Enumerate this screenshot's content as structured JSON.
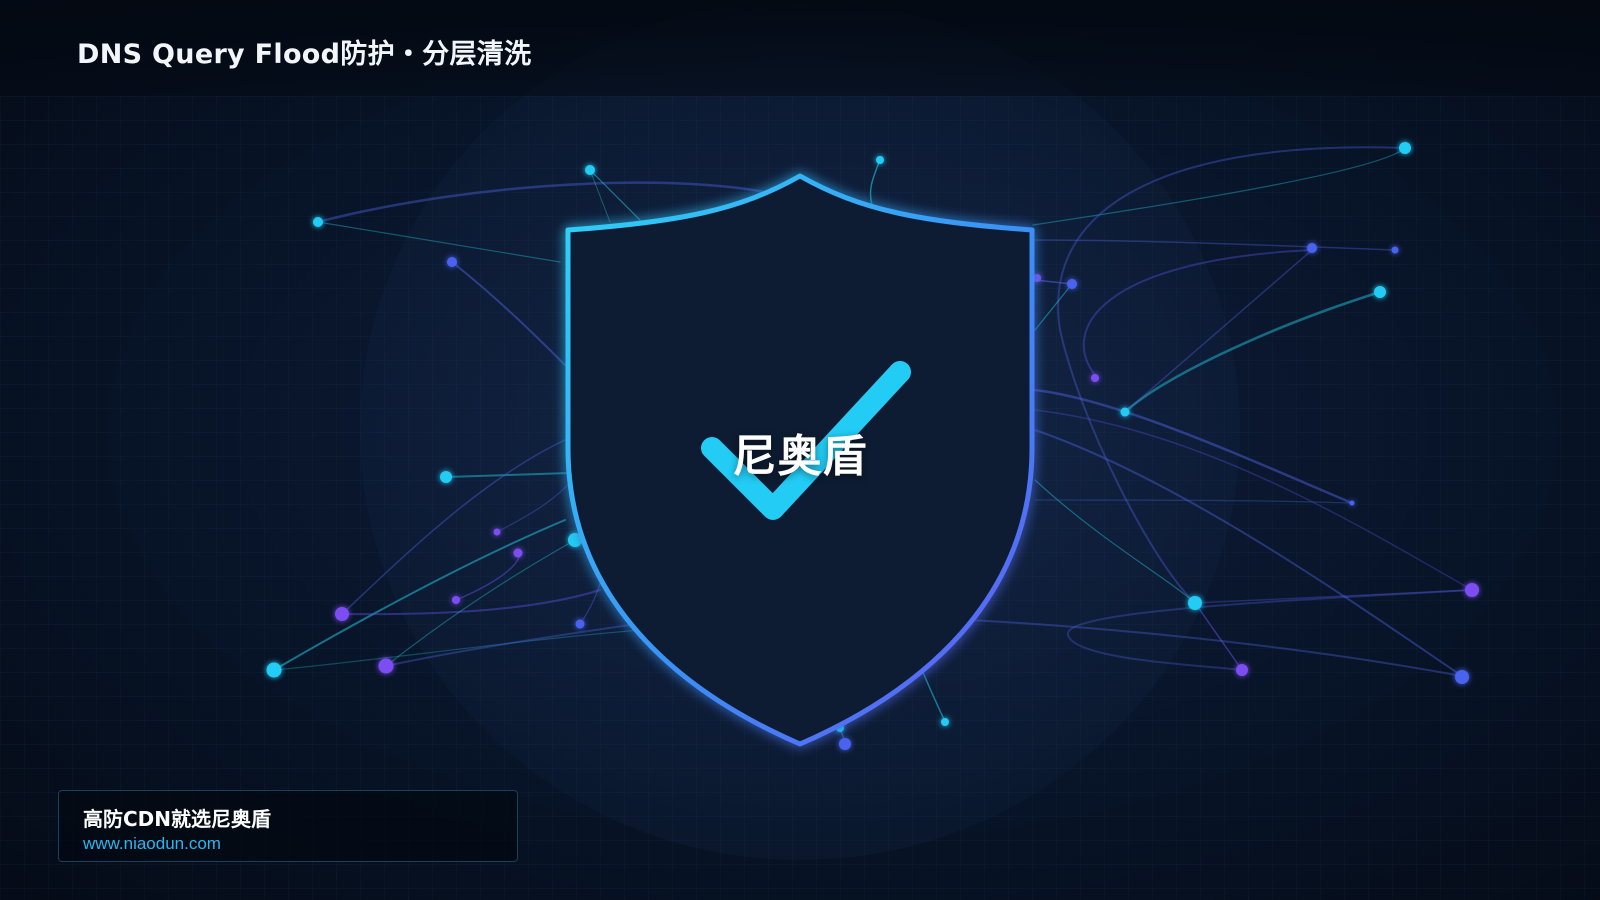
{
  "header": {
    "title": "DNS Query Flood防护・分层清洗"
  },
  "shield": {
    "label": "尼奥盾",
    "icon": "shield-check-icon",
    "stroke_gradient": [
      "#2ec6f5",
      "#5b6cf6"
    ],
    "check_color": "#22ccf5"
  },
  "brand": {
    "name": "高防CDN就选尼奥盾",
    "url": "www.niaodun.com"
  },
  "colors": {
    "background": "#060d18",
    "accent_cyan": "#22ccf5",
    "accent_violet": "#7b4df2",
    "accent_blue": "#4a63f0",
    "url": "#2ab6f2"
  }
}
